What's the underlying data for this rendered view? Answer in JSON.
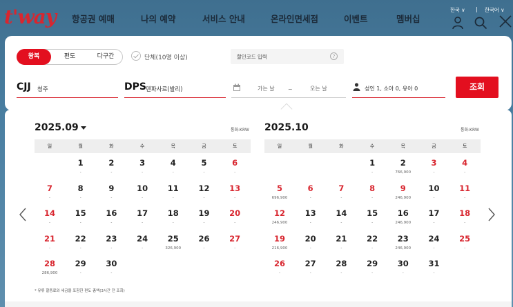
{
  "header": {
    "logo": "t'way",
    "nav": [
      "항공권 예매",
      "나의 예약",
      "서비스 안내",
      "온라인면세점",
      "이벤트",
      "멤버십"
    ],
    "lang": [
      "한국 ∨",
      "|",
      "한국어 ∨"
    ]
  },
  "search": {
    "trip_types": [
      "왕복",
      "편도",
      "다구간"
    ],
    "active_trip_type": "왕복",
    "group_label": "단체(10명 이상)",
    "promo_placeholder": "할인코드 입력",
    "origin_code": "CJJ",
    "origin_city": "청주",
    "dest_code": "DPS",
    "dest_city": "덴파사르(발리)",
    "depart_placeholder": "가는 날",
    "date_separator": "~",
    "return_placeholder": "오는 날",
    "passengers": "성인 1, 소아 0, 유아 0",
    "search_label": "조회"
  },
  "calendar": {
    "currency": "통화:KRW",
    "weekdays": [
      "일",
      "월",
      "화",
      "수",
      "목",
      "금",
      "토"
    ],
    "footnote": "* 유류 할증료와 세금을 포함한 편도 총액(3시간 전 조회)",
    "months": [
      {
        "title": "2025.09",
        "has_dropdown": true,
        "first_weekday": 1,
        "days": [
          {
            "d": "1",
            "p": "-"
          },
          {
            "d": "2",
            "p": "-"
          },
          {
            "d": "3",
            "p": "-"
          },
          {
            "d": "4",
            "p": "-"
          },
          {
            "d": "5",
            "p": "-"
          },
          {
            "d": "6",
            "p": "-"
          },
          {
            "d": "7",
            "p": "-"
          },
          {
            "d": "8",
            "p": "-"
          },
          {
            "d": "9",
            "p": "-"
          },
          {
            "d": "10",
            "p": "-"
          },
          {
            "d": "11",
            "p": "-"
          },
          {
            "d": "12",
            "p": "-"
          },
          {
            "d": "13",
            "p": "-"
          },
          {
            "d": "14",
            "p": "-"
          },
          {
            "d": "15",
            "p": "-"
          },
          {
            "d": "16",
            "p": "-"
          },
          {
            "d": "17",
            "p": "-"
          },
          {
            "d": "18",
            "p": "-"
          },
          {
            "d": "19",
            "p": "-"
          },
          {
            "d": "20",
            "p": "-"
          },
          {
            "d": "21",
            "p": "-"
          },
          {
            "d": "22",
            "p": "-"
          },
          {
            "d": "23",
            "p": "-"
          },
          {
            "d": "24",
            "p": "-"
          },
          {
            "d": "25",
            "p": "326,900"
          },
          {
            "d": "26",
            "p": "-"
          },
          {
            "d": "27",
            "p": "-"
          },
          {
            "d": "28",
            "p": "286,900"
          },
          {
            "d": "29",
            "p": "-"
          },
          {
            "d": "30",
            "p": "-"
          }
        ]
      },
      {
        "title": "2025.10",
        "has_dropdown": false,
        "first_weekday": 3,
        "days": [
          {
            "d": "1",
            "p": "-"
          },
          {
            "d": "2",
            "p": "766,900"
          },
          {
            "d": "3",
            "p": "-"
          },
          {
            "d": "4",
            "p": "-"
          },
          {
            "d": "5",
            "p": "696,900"
          },
          {
            "d": "6",
            "p": "-"
          },
          {
            "d": "7",
            "p": "-"
          },
          {
            "d": "8",
            "p": "-"
          },
          {
            "d": "9",
            "p": "246,900"
          },
          {
            "d": "10",
            "p": "-"
          },
          {
            "d": "11",
            "p": "-"
          },
          {
            "d": "12",
            "p": "246,900"
          },
          {
            "d": "13",
            "p": "-"
          },
          {
            "d": "14",
            "p": "-"
          },
          {
            "d": "15",
            "p": "-"
          },
          {
            "d": "16",
            "p": "246,900"
          },
          {
            "d": "17",
            "p": "-"
          },
          {
            "d": "18",
            "p": "-"
          },
          {
            "d": "19",
            "p": "216,900"
          },
          {
            "d": "20",
            "p": "-"
          },
          {
            "d": "21",
            "p": "-"
          },
          {
            "d": "22",
            "p": "-"
          },
          {
            "d": "23",
            "p": "246,900"
          },
          {
            "d": "24",
            "p": "-"
          },
          {
            "d": "25",
            "p": "-"
          },
          {
            "d": "26",
            "p": "-"
          },
          {
            "d": "27",
            "p": "-"
          },
          {
            "d": "28",
            "p": "-"
          },
          {
            "d": "29",
            "p": "-"
          },
          {
            "d": "30",
            "p": "-"
          },
          {
            "d": "31",
            "p": "-"
          }
        ]
      }
    ],
    "holiday_days_red": [
      [
        "6",
        "7",
        "13",
        "14",
        "20",
        "21",
        "27",
        "28"
      ],
      [
        "3",
        "4",
        "5",
        "6",
        "7",
        "8",
        "9",
        "11",
        "12",
        "18",
        "19",
        "25",
        "26"
      ]
    ]
  },
  "colors": {
    "brand": "#e30f1f",
    "holiday": "#d8262f"
  }
}
